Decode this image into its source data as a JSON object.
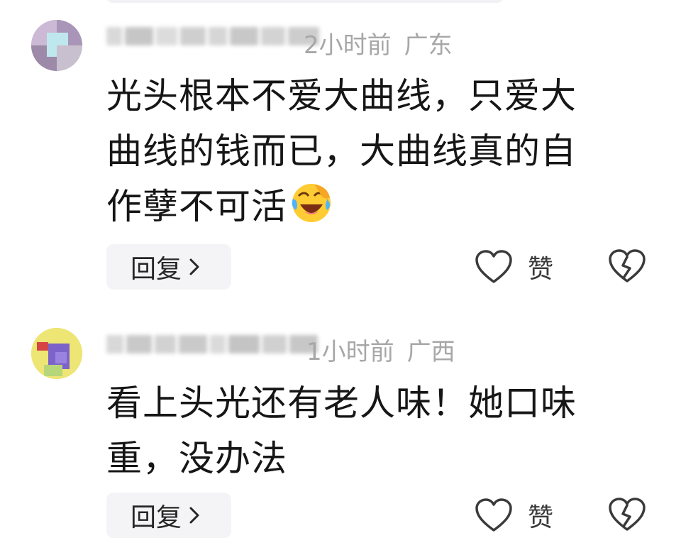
{
  "comments": [
    {
      "time": "2小时前",
      "location": "广东",
      "text_lines": [
        "光头根本不爱大曲线，只爱大",
        "曲线的钱而已，大曲线真的自",
        "作孽不可活"
      ],
      "emoji": "face-with-tears-of-joy-emoji",
      "reply_label": "回复",
      "like_label": "赞"
    },
    {
      "time": "1小时前",
      "location": "广西",
      "text_lines": [
        "看上头光还有老人味！她口味",
        "重，没办法"
      ],
      "reply_label": "回复",
      "like_label": "赞"
    }
  ],
  "icons": {
    "reply_chevron": "chevron-right-icon",
    "like": "heart-outline-icon",
    "dislike": "broken-heart-icon"
  },
  "colors": {
    "meta_text": "#a7a7a7",
    "body_text": "#161616",
    "reply_bg": "#f4f4f6",
    "icon_stroke": "#3a3a3a"
  }
}
